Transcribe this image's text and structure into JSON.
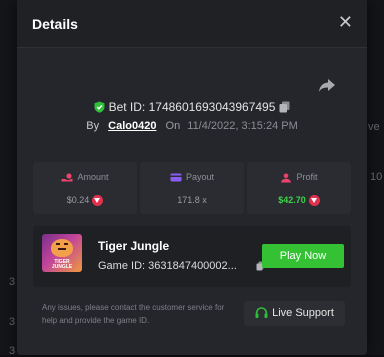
{
  "header": {
    "title": "Details"
  },
  "bet": {
    "label": "Bet ID: 1748601693043967495",
    "by_label": "By",
    "username": "Calo0420",
    "on_label": "On",
    "datetime": "11/4/2022, 3:15:24 PM"
  },
  "stats": {
    "amount": {
      "label": "Amount",
      "value": "$0.24"
    },
    "payout": {
      "label": "Payout",
      "value": "171.8 x"
    },
    "profit": {
      "label": "Profit",
      "value": "$42.70"
    }
  },
  "game": {
    "name": "Tiger Jungle",
    "id_text": "Game ID: 3631847400002...",
    "thumb_text": "TIGER JUNGLE",
    "play_label": "Play Now"
  },
  "support": {
    "message": "Any issues, please contact the customer service for help and provide the game ID.",
    "button_label": "Live Support"
  },
  "background": {
    "right_fragment_1": "ve",
    "right_fragment_2": "10",
    "left_fragment_1": "3",
    "left_fragment_2": "3",
    "left_fragment_3": "3"
  },
  "colors": {
    "accent_green": "#34c234",
    "profit_green": "#3fd24a",
    "coin_red": "#e2314f",
    "icon_pink": "#e8436b",
    "icon_purple": "#8a5cf6"
  }
}
